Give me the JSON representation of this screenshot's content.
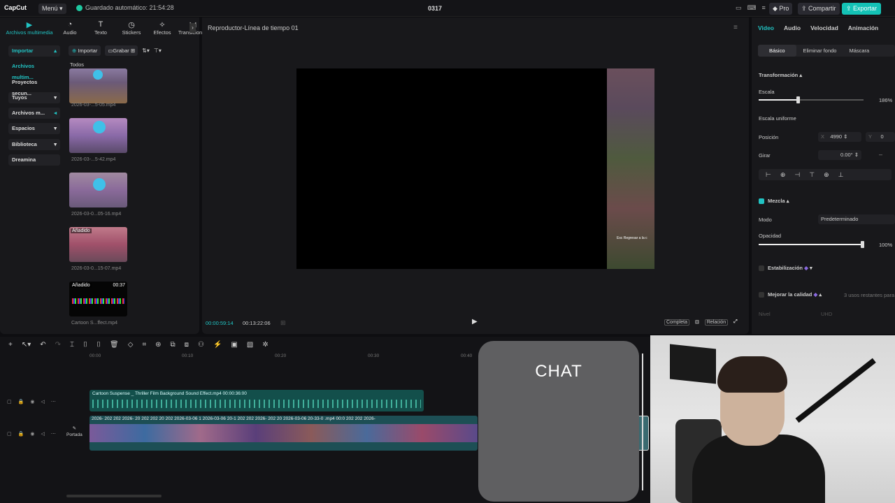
{
  "top": {
    "logo": "CapCut",
    "menu": "Menú",
    "autosave": "Guardado automático: 21:54:28",
    "project": "0317",
    "pro": "Pro",
    "share": "Compartir",
    "export": "Exportar"
  },
  "media_tabs": [
    "Archivos multimedia",
    "Audio",
    "Texto",
    "Stickers",
    "Efectos",
    "Transiciones"
  ],
  "leftnav": [
    "Importar",
    "Archivos multim...",
    "Proyectos secun...",
    "Tuyos",
    "Archivos m...",
    "Espacios",
    "Biblioteca",
    "Dreamina"
  ],
  "media_bar": {
    "import": "Importar",
    "record": "Grabar",
    "all": "Todos"
  },
  "media_items": [
    {
      "label": "2026-03-...5-05.mp4",
      "badge": "",
      "duration": ""
    },
    {
      "label": "2026-03-...5-42.mp4",
      "badge": "",
      "duration": ""
    },
    {
      "label": "2026-03-0...05-16.mp4",
      "badge": "",
      "duration": ""
    },
    {
      "label": "2026-03-0...15-07.mp4",
      "badge": "Añadido",
      "duration": ""
    },
    {
      "label": "Cartoon S...ffect.mp4",
      "badge": "Añadido",
      "duration": "00:37"
    }
  ],
  "player": {
    "title": "Reproductor-Línea de tiempo 01",
    "current_time": "00:00:59:14",
    "total_time": "00:13:22:06",
    "full": "Completa",
    "ratio": "Relación",
    "game_text": "Esc Regresar a la c"
  },
  "right": {
    "tabs": [
      "Video",
      "Audio",
      "Velocidad",
      "Animación"
    ],
    "subtabs": [
      "Básico",
      "Eliminar fondo",
      "Máscara"
    ],
    "transform": "Transformación",
    "scale_label": "Escala",
    "scale_value": "186%",
    "scale_fraction": 0.37,
    "uniform": "Escala uniforme",
    "position": "Posición",
    "pos_x_label": "X",
    "pos_x": "4990",
    "pos_y_label": "Y",
    "pos_y": "0",
    "rotate": "Girar",
    "rotate_value": "0.00°",
    "blend": "Mezcla",
    "mode": "Modo",
    "mode_value": "Predeterminado",
    "opacity": "Opacidad",
    "opacity_value": "100%",
    "stabilize": "Estabilización",
    "enhance": "Mejorar la calidad",
    "enhance_uses": "3 usos restantes para",
    "level": "Nivel",
    "level_value": "UHD"
  },
  "timeline": {
    "ruler": [
      "00:00",
      "00:10",
      "00:20",
      "00:30",
      "00:40"
    ],
    "audio_clip": "Cartoon Suspense _ Thriller Film Background Sound Effect.mp4   00:00:36:00",
    "video_clip_titles": "2026-  202  202  2026-  20  202  202  20  202  2026-03-06 1  2026-03-06 20-1  202  202  2026-  202  20  2026-03-06 20-33-0  .mp4  00:0  202  202  2026-",
    "cover": "Portada"
  },
  "chat_label": "CHAT",
  "colors": {
    "accent": "#21c3c3",
    "export": "#14c2b5",
    "panel": "#18181b"
  }
}
